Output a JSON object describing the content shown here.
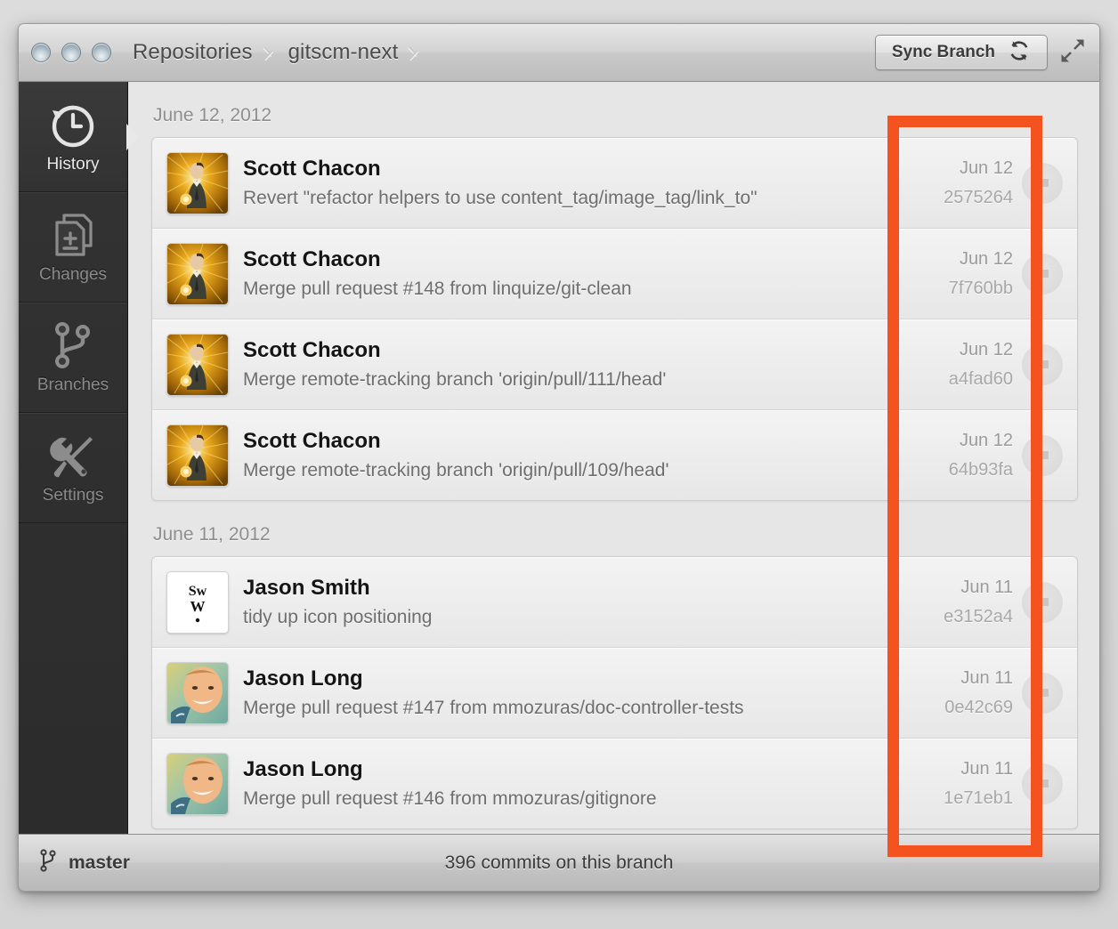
{
  "window": {
    "traffic_lights": [
      "close-button",
      "minimize-button",
      "zoom-button"
    ],
    "breadcrumb": [
      "Repositories",
      "gitscm-next"
    ],
    "sync_button_label": "Sync Branch",
    "sync_icon": "refresh-icon",
    "expand_icon": "expand-arrows-icon"
  },
  "sidebar": {
    "items": [
      {
        "label": "History",
        "icon": "history-clock-icon",
        "active": true
      },
      {
        "label": "Changes",
        "icon": "document-plus-minus-icon",
        "active": false
      },
      {
        "label": "Branches",
        "icon": "branch-fork-icon",
        "active": false
      },
      {
        "label": "Settings",
        "icon": "wrench-screwdriver-icon",
        "active": false
      }
    ]
  },
  "history": {
    "groups": [
      {
        "date_header": "June 12, 2012",
        "commits": [
          {
            "author": "Scott Chacon",
            "message": "Revert \"refactor helpers to use content_tag/image_tag/link_to\"",
            "date": "Jun 12",
            "sha": "2575264",
            "avatar": "scott-chacon-avatar",
            "action_icon": "ellipsis-button"
          },
          {
            "author": "Scott Chacon",
            "message": "Merge pull request #148 from linquize/git-clean",
            "date": "Jun 12",
            "sha": "7f760bb",
            "avatar": "scott-chacon-avatar",
            "action_icon": "ellipsis-button"
          },
          {
            "author": "Scott Chacon",
            "message": "Merge remote-tracking branch 'origin/pull/111/head'",
            "date": "Jun 12",
            "sha": "a4fad60",
            "avatar": "scott-chacon-avatar",
            "action_icon": "ellipsis-button"
          },
          {
            "author": "Scott Chacon",
            "message": "Merge remote-tracking branch 'origin/pull/109/head'",
            "date": "Jun 12",
            "sha": "64b93fa",
            "avatar": "scott-chacon-avatar",
            "action_icon": "ellipsis-button"
          }
        ]
      },
      {
        "date_header": "June 11, 2012",
        "commits": [
          {
            "author": "Jason Smith",
            "message": "tidy up icon positioning",
            "date": "Jun 11",
            "sha": "e3152a4",
            "avatar": "sww-logo-avatar",
            "action_icon": "ellipsis-button"
          },
          {
            "author": "Jason Long",
            "message": "Merge pull request #147 from mmozuras/doc-controller-tests",
            "date": "Jun 11",
            "sha": "0e42c69",
            "avatar": "jason-long-avatar",
            "action_icon": "ellipsis-button"
          },
          {
            "author": "Jason Long",
            "message": "Merge pull request #146 from mmozuras/gitignore",
            "date": "Jun 11",
            "sha": "1e71eb1",
            "avatar": "jason-long-avatar",
            "action_icon": "ellipsis-button"
          }
        ]
      }
    ]
  },
  "statusbar": {
    "branch_icon": "branch-fork-icon",
    "branch_name": "master",
    "commit_count_text": "396 commits on this branch"
  },
  "annotation": {
    "color": "#f4521f",
    "shape": "rectangle-highlight"
  },
  "avatar_logo": {
    "line1": "Sw",
    "line2": "W",
    "line3": "·"
  }
}
